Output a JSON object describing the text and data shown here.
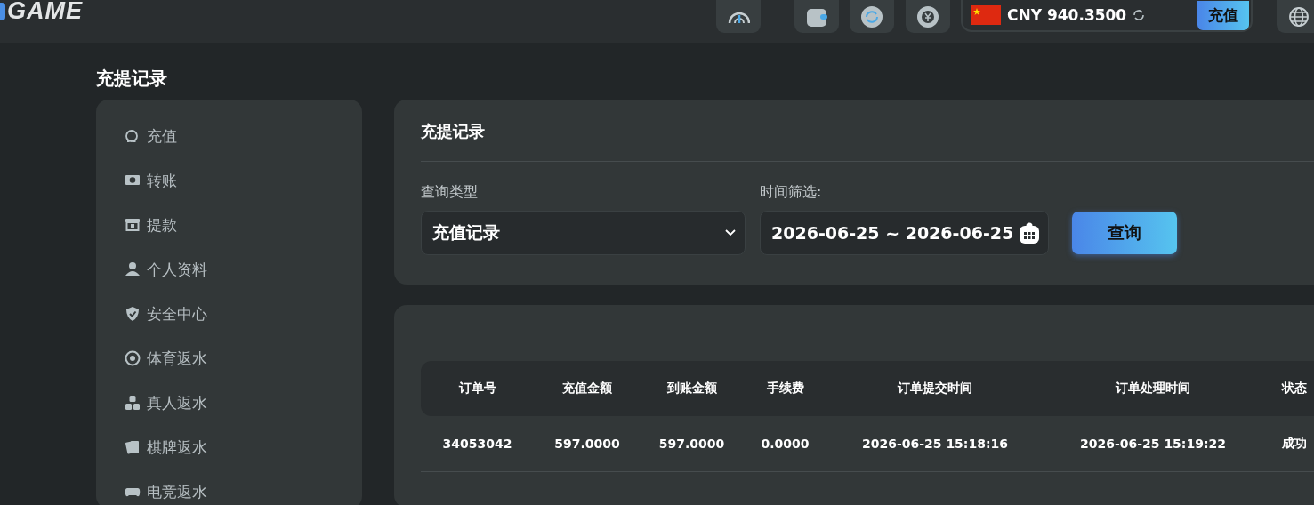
{
  "header": {
    "logo": "GAME",
    "balance": {
      "currency": "CNY 940.3500",
      "deposit_button": "充值"
    }
  },
  "page_title": "充提记录",
  "sidebar": {
    "items": [
      {
        "label": "充值"
      },
      {
        "label": "转账"
      },
      {
        "label": "提款"
      },
      {
        "label": "个人资料"
      },
      {
        "label": "安全中心"
      },
      {
        "label": "体育返水"
      },
      {
        "label": "真人返水"
      },
      {
        "label": "棋牌返水"
      },
      {
        "label": "电竞返水"
      }
    ]
  },
  "filter_card": {
    "title": "充提记录",
    "type_label": "查询类型",
    "type_value": "充值记录",
    "time_label": "时间筛选:",
    "date_range": "2026-06-25 ~ 2026-06-25",
    "query_button": "查询"
  },
  "table": {
    "columns": [
      "订单号",
      "充值金额",
      "到账金额",
      "手续费",
      "订单提交时间",
      "订单处理时间",
      "状态"
    ],
    "rows": [
      [
        "34053042",
        "597.0000",
        "597.0000",
        "0.0000",
        "2026-06-25 15:18:16",
        "2026-06-25 15:19:22",
        "成功"
      ]
    ]
  }
}
